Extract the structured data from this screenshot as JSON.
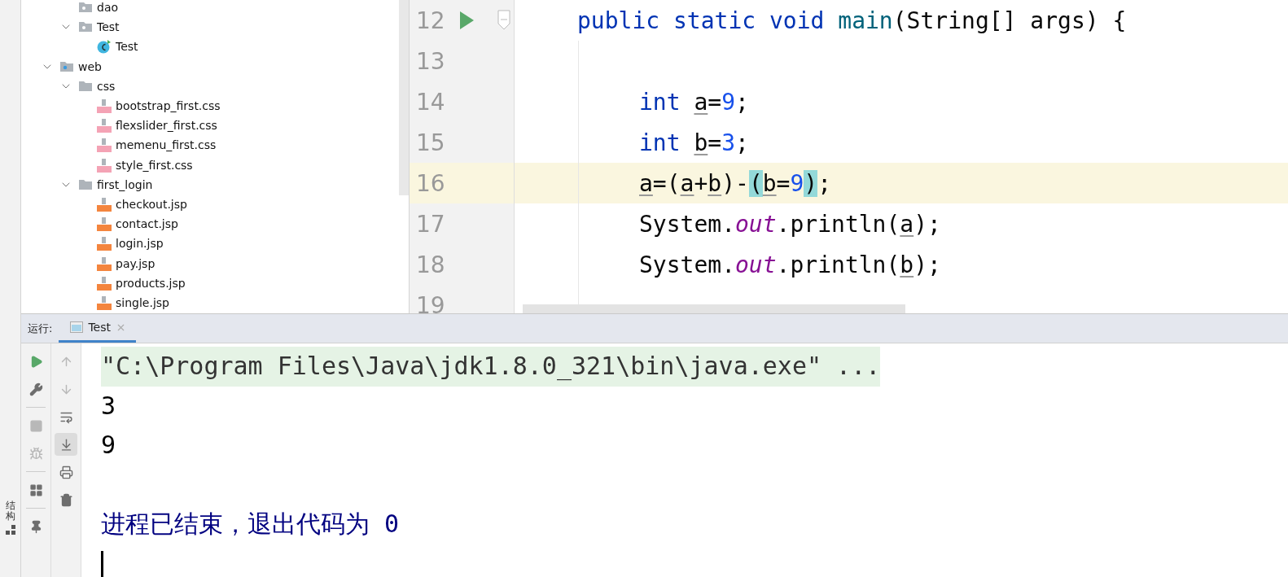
{
  "sidebar_strip": {
    "label": "结构"
  },
  "project_tree": [
    {
      "kind": "hidden",
      "children": [
        {
          "label": "dao",
          "kind": "package"
        },
        {
          "label": "Test",
          "kind": "package",
          "expanded": true,
          "children": [
            {
              "label": "Test",
              "kind": "class"
            }
          ]
        }
      ]
    },
    {
      "label": "web",
      "kind": "web-folder",
      "expanded": true,
      "children": [
        {
          "label": "css",
          "kind": "folder",
          "expanded": true,
          "children": [
            {
              "label": "bootstrap_first.css",
              "kind": "css"
            },
            {
              "label": "flexslider_first.css",
              "kind": "css"
            },
            {
              "label": "memenu_first.css",
              "kind": "css"
            },
            {
              "label": "style_first.css",
              "kind": "css"
            }
          ]
        },
        {
          "label": "first_login",
          "kind": "folder",
          "expanded": true,
          "children": [
            {
              "label": "checkout.jsp",
              "kind": "jsp"
            },
            {
              "label": "contact.jsp",
              "kind": "jsp"
            },
            {
              "label": "login.jsp",
              "kind": "jsp"
            },
            {
              "label": "pay.jsp",
              "kind": "jsp"
            },
            {
              "label": "products.jsp",
              "kind": "jsp"
            },
            {
              "label": "single.jsp",
              "kind": "jsp"
            }
          ]
        }
      ]
    }
  ],
  "editor": {
    "lines": [
      {
        "number": "12",
        "current": false,
        "run_marker": true,
        "tokens": [
          {
            "text": "public static void ",
            "kind": "keyword"
          },
          {
            "text": "main",
            "kind": "method"
          },
          {
            "text": "(String[] args) {",
            "kind": "plain"
          }
        ],
        "children": [
          {
            "number": "13",
            "current": false,
            "run_marker": false
          },
          {
            "number": "14",
            "current": false,
            "run_marker": false,
            "tokens": [
              {
                "text": "int ",
                "kind": "keyword"
              },
              {
                "text": "a",
                "kind": "var"
              },
              {
                "text": "=",
                "kind": "plain"
              },
              {
                "text": "9",
                "kind": "number"
              },
              {
                "text": ";",
                "kind": "plain"
              }
            ]
          },
          {
            "number": "15",
            "current": false,
            "run_marker": false,
            "tokens": [
              {
                "text": "int ",
                "kind": "keyword"
              },
              {
                "text": "b",
                "kind": "var"
              },
              {
                "text": "=",
                "kind": "plain"
              },
              {
                "text": "3",
                "kind": "number"
              },
              {
                "text": ";",
                "kind": "plain"
              }
            ]
          },
          {
            "number": "16",
            "current": true,
            "run_marker": false,
            "tokens": [
              {
                "text": "a",
                "kind": "var"
              },
              {
                "text": "=(",
                "kind": "plain"
              },
              {
                "text": "a",
                "kind": "var"
              },
              {
                "text": "+",
                "kind": "plain"
              },
              {
                "text": "b",
                "kind": "var"
              },
              {
                "text": ")-",
                "kind": "plain"
              },
              {
                "text": "(",
                "kind": "brace"
              },
              {
                "text": "b",
                "kind": "var"
              },
              {
                "text": "=",
                "kind": "plain"
              },
              {
                "text": "9",
                "kind": "number"
              },
              {
                "text": ")",
                "kind": "brace"
              },
              {
                "text": ";",
                "kind": "plain"
              }
            ]
          },
          {
            "number": "17",
            "current": false,
            "run_marker": false,
            "tokens": [
              {
                "text": "System.",
                "kind": "plain"
              },
              {
                "text": "out",
                "kind": "static"
              },
              {
                "text": ".println(",
                "kind": "plain"
              },
              {
                "text": "a",
                "kind": "var"
              },
              {
                "text": ");",
                "kind": "plain"
              }
            ]
          },
          {
            "number": "18",
            "current": false,
            "run_marker": false,
            "tokens": [
              {
                "text": "System.",
                "kind": "plain"
              },
              {
                "text": "out",
                "kind": "static"
              },
              {
                "text": ".println(",
                "kind": "plain"
              },
              {
                "text": "b",
                "kind": "var"
              },
              {
                "text": ");",
                "kind": "plain"
              }
            ]
          },
          {
            "number": "19",
            "current": false,
            "run_marker": false
          }
        ]
      }
    ]
  },
  "run_panel": {
    "label": "运行:",
    "tabs": [
      {
        "label": "Test",
        "selected": true
      }
    ],
    "left_tools": [
      {
        "kind": "run",
        "disabled": false
      },
      {
        "kind": "wrench",
        "disabled": false
      },
      {
        "kind": "separator"
      },
      {
        "kind": "stop",
        "disabled": true
      },
      {
        "kind": "bug",
        "disabled": true
      },
      {
        "kind": "separator"
      },
      {
        "kind": "layout",
        "disabled": false
      },
      {
        "kind": "separator"
      },
      {
        "kind": "pin",
        "disabled": false
      }
    ],
    "console_tools": [
      {
        "kind": "up",
        "on": false,
        "disabled": true
      },
      {
        "kind": "down",
        "on": false,
        "disabled": true
      },
      {
        "kind": "wrap",
        "on": false,
        "disabled": false
      },
      {
        "kind": "scroll-end",
        "on": true,
        "disabled": false
      },
      {
        "kind": "print",
        "on": false,
        "disabled": false
      },
      {
        "kind": "trash",
        "on": false,
        "disabled": false
      }
    ],
    "console": [
      {
        "kind": "command",
        "text": "\"C:\\Program Files\\Java\\jdk1.8.0_321\\bin\\java.exe\" ..."
      },
      {
        "kind": "output",
        "text": "3"
      },
      {
        "kind": "output",
        "text": "9"
      },
      {
        "kind": "blank"
      },
      {
        "kind": "exit",
        "text": "进程已结束，退出代码为 0"
      }
    ]
  }
}
